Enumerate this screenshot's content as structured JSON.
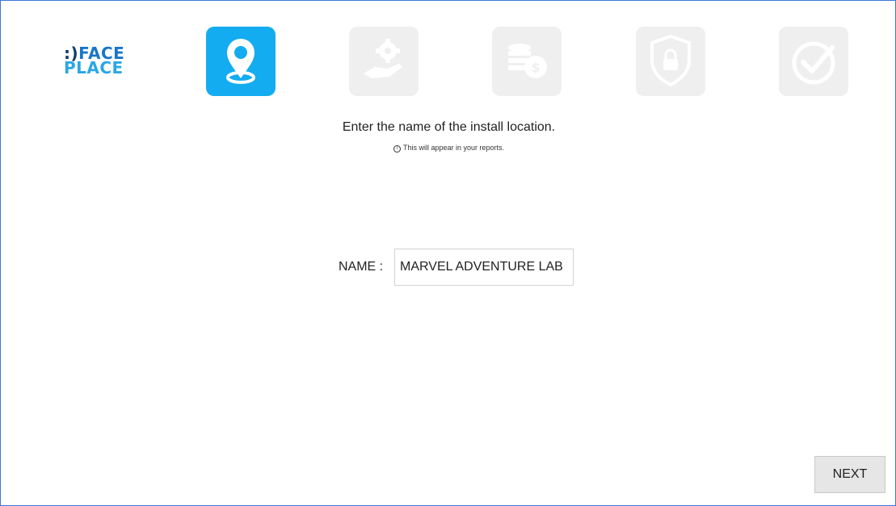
{
  "logo": {
    "line1_prefix": ":)",
    "line1_word": "FACE",
    "line2": "PLACE"
  },
  "steps": [
    {
      "icon": "location-pin-icon",
      "state": "active"
    },
    {
      "icon": "hand-gear-icon",
      "state": "inactive"
    },
    {
      "icon": "coins-dollar-icon",
      "state": "inactive"
    },
    {
      "icon": "shield-lock-icon",
      "state": "inactive"
    },
    {
      "icon": "checkmark-icon",
      "state": "inactive"
    }
  ],
  "colors": {
    "active_step": "#14acf0",
    "inactive_step": "#efefef",
    "window_border": "#3c78d8"
  },
  "main": {
    "title": "Enter the name of the install location.",
    "hint": "This will appear in your reports.",
    "name_label": "NAME :",
    "name_value": "MARVEL ADVENTURE LAB"
  },
  "footer": {
    "next_label": "NEXT"
  }
}
